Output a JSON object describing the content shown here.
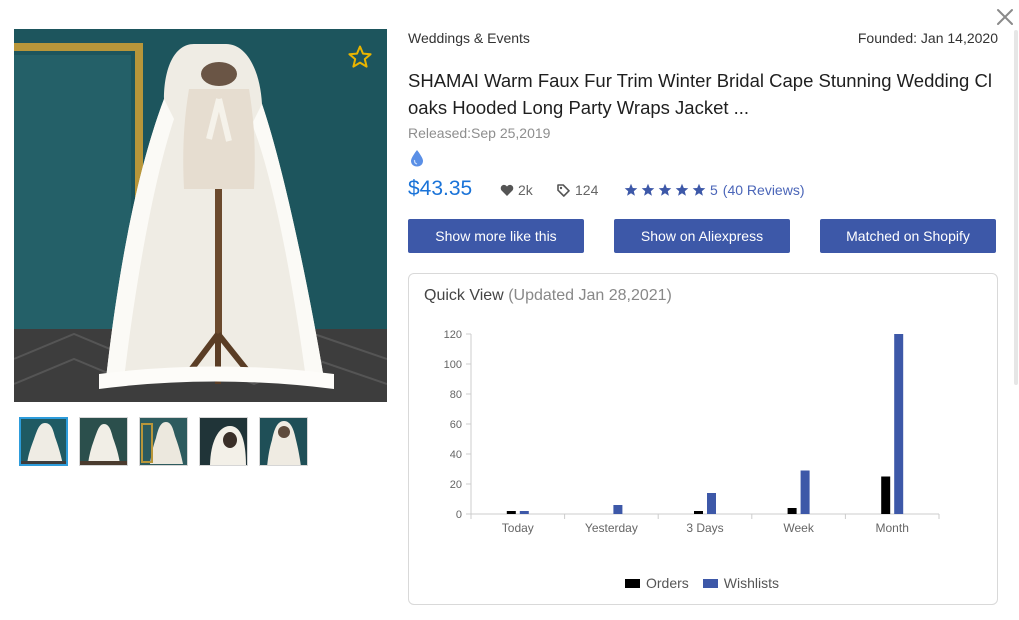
{
  "product": {
    "category": "Weddings & Events",
    "founded": "Founded: Jan 14,2020",
    "title": "SHAMAI Warm Faux Fur Trim Winter Bridal Cape Stunning Wedding Cloaks Hooded Long Party Wraps Jacket ...",
    "released": "Released:Sep 25,2019",
    "price": "$43.35",
    "likes": "2k",
    "tags": "124",
    "rating_count": "5",
    "reviews": "(40 Reviews)",
    "stars": 5
  },
  "buttons": {
    "more_like_this": "Show more like this",
    "aliexpress": "Show on Aliexpress",
    "shopify": "Matched on Shopify"
  },
  "quick_view": {
    "title": "Quick View",
    "updated": "(Updated Jan 28,2021)"
  },
  "colors": {
    "accent": "#3d58a8",
    "price": "#1a73d8",
    "orders": "#000000",
    "wishlists": "#3d58a8"
  },
  "chart_data": {
    "type": "bar",
    "categories": [
      "Today",
      "Yesterday",
      "3 Days",
      "Week",
      "Month"
    ],
    "series": [
      {
        "name": "Orders",
        "values": [
          2,
          0,
          2,
          4,
          25
        ]
      },
      {
        "name": "Wishlists",
        "values": [
          2,
          6,
          14,
          29,
          120
        ]
      }
    ],
    "yticks": [
      0,
      20,
      40,
      60,
      80,
      100,
      120
    ],
    "ylim": [
      0,
      120
    ],
    "legend": "bottom"
  }
}
